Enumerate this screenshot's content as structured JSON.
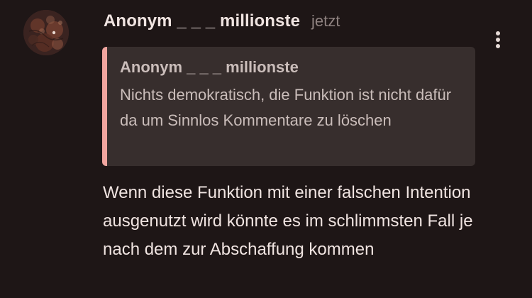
{
  "comment": {
    "author": "Anonym _ _ _ millionste",
    "timestamp": "jetzt",
    "avatar_icon": "avatar-photo",
    "menu_icon": "more-vertical-icon",
    "quote": {
      "author": "Anonym _ _ _ millionste",
      "text": "Nichts demokratisch, die Funktion ist nicht dafür da um Sinnlos Kommentare zu löschen",
      "accent_color": "#f1a59f"
    },
    "body": "Wenn diese Funktion mit einer falschen Intention ausgenutzt wird könnte es im schlimmsten Fall je nach dem zur Abschaffung kommen"
  },
  "colors": {
    "background": "#1e1616",
    "quote_background": "#372e2d",
    "quote_accent": "#f1a59f",
    "text_primary": "#f0e4e1",
    "text_secondary": "#8f8280"
  }
}
